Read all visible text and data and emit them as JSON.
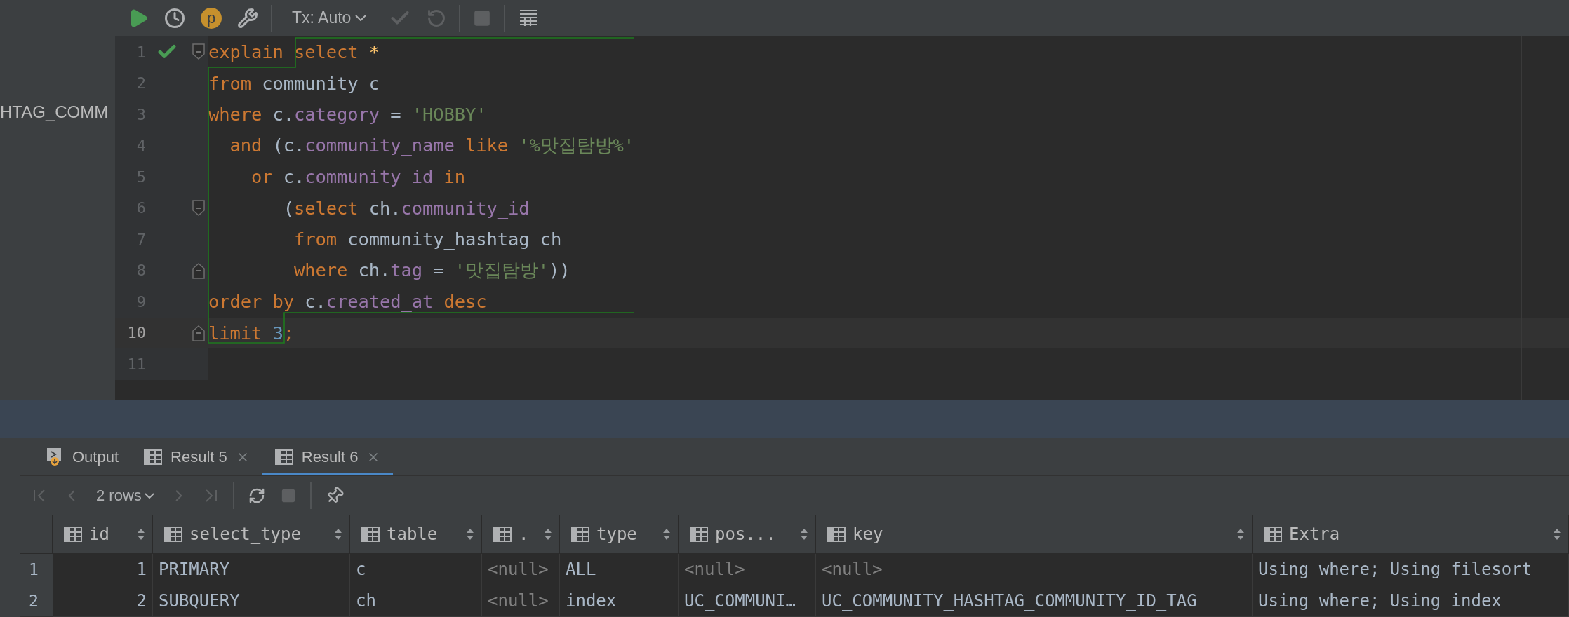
{
  "left_panel": {
    "text": "HTAG_COMM"
  },
  "toolbar": {
    "items": [
      {
        "kind": "run",
        "disabled": false
      },
      {
        "kind": "history",
        "disabled": false
      },
      {
        "kind": "profile",
        "label": "p",
        "disabled": false
      },
      {
        "kind": "settings",
        "disabled": false
      },
      {
        "kind": "separator"
      },
      {
        "kind": "tx",
        "label": "Tx: Auto",
        "disabled": false
      },
      {
        "kind": "commit",
        "disabled": true
      },
      {
        "kind": "rollback",
        "disabled": true
      },
      {
        "kind": "separator"
      },
      {
        "kind": "stop",
        "disabled": true
      },
      {
        "kind": "separator"
      },
      {
        "kind": "table",
        "disabled": false
      }
    ]
  },
  "editor": {
    "lines": [
      {
        "number": "1",
        "check": true,
        "current": false,
        "fold_start": true,
        "fold_end": false,
        "tokens": [
          {
            "kind": "keyword",
            "text": "explain select "
          },
          {
            "kind": "star",
            "text": "*"
          }
        ]
      },
      {
        "number": "2",
        "check": false,
        "current": false,
        "fold_start": false,
        "fold_end": false,
        "tokens": [
          {
            "kind": "keyword",
            "text": "from "
          },
          {
            "kind": "ident",
            "text": "community c"
          }
        ]
      },
      {
        "number": "3",
        "check": false,
        "current": false,
        "fold_start": false,
        "fold_end": false,
        "tokens": [
          {
            "kind": "keyword",
            "text": "where "
          },
          {
            "kind": "ident",
            "text": "c."
          },
          {
            "kind": "field",
            "text": "category"
          },
          {
            "kind": "ident",
            "text": " = "
          },
          {
            "kind": "string",
            "text": "'HOBBY'"
          }
        ]
      },
      {
        "number": "4",
        "check": false,
        "current": false,
        "fold_start": false,
        "fold_end": false,
        "tokens": [
          {
            "kind": "keyword",
            "text": "  and "
          },
          {
            "kind": "ident",
            "text": "(c."
          },
          {
            "kind": "field",
            "text": "community_name"
          },
          {
            "kind": "keyword",
            "text": " like "
          },
          {
            "kind": "string",
            "text": "'%맛집탐방%'"
          }
        ]
      },
      {
        "number": "5",
        "check": false,
        "current": false,
        "fold_start": false,
        "fold_end": false,
        "tokens": [
          {
            "kind": "keyword",
            "text": "    or "
          },
          {
            "kind": "ident",
            "text": "c."
          },
          {
            "kind": "field",
            "text": "community_id"
          },
          {
            "kind": "keyword",
            "text": " in"
          }
        ]
      },
      {
        "number": "6",
        "check": false,
        "current": false,
        "fold_start": true,
        "fold_end": false,
        "tokens": [
          {
            "kind": "ident",
            "text": "       ("
          },
          {
            "kind": "keyword",
            "text": "select "
          },
          {
            "kind": "ident",
            "text": "ch."
          },
          {
            "kind": "field",
            "text": "community_id"
          }
        ]
      },
      {
        "number": "7",
        "check": false,
        "current": false,
        "fold_start": false,
        "fold_end": false,
        "tokens": [
          {
            "kind": "keyword",
            "text": "        from "
          },
          {
            "kind": "ident",
            "text": "community_hashtag ch"
          }
        ]
      },
      {
        "number": "8",
        "check": false,
        "current": false,
        "fold_start": false,
        "fold_end": true,
        "tokens": [
          {
            "kind": "keyword",
            "text": "        where "
          },
          {
            "kind": "ident",
            "text": "ch."
          },
          {
            "kind": "field",
            "text": "tag"
          },
          {
            "kind": "ident",
            "text": " = "
          },
          {
            "kind": "string",
            "text": "'맛집탐방'"
          },
          {
            "kind": "ident",
            "text": "))"
          }
        ]
      },
      {
        "number": "9",
        "check": false,
        "current": false,
        "fold_start": false,
        "fold_end": false,
        "tokens": [
          {
            "kind": "keyword",
            "text": "order by "
          },
          {
            "kind": "ident",
            "text": "c."
          },
          {
            "kind": "field",
            "text": "created_at"
          },
          {
            "kind": "keyword",
            "text": " desc"
          }
        ]
      },
      {
        "number": "10",
        "check": false,
        "current": true,
        "fold_start": false,
        "fold_end": true,
        "tokens": [
          {
            "kind": "keyword",
            "text": "limit "
          },
          {
            "kind": "number",
            "text": "3"
          },
          {
            "kind": "keyword",
            "text": ";"
          }
        ]
      },
      {
        "number": "11",
        "check": false,
        "current": false,
        "fold_start": false,
        "fold_end": false
      }
    ]
  },
  "result_tabs": [
    {
      "kind": "output",
      "label": "Output",
      "selected": false,
      "closable": false
    },
    {
      "kind": "table",
      "label": "Result 5",
      "selected": false,
      "closable": true
    },
    {
      "kind": "table",
      "label": "Result 6",
      "selected": true,
      "closable": true
    }
  ],
  "result_toolbar": {
    "rows_label": "2 rows"
  },
  "table": {
    "columns": [
      {
        "name": "id",
        "kind": "number"
      },
      {
        "name": "select_type",
        "kind": "text"
      },
      {
        "name": "table",
        "kind": "text"
      },
      {
        "name": ".",
        "kind": "text"
      },
      {
        "name": "type",
        "kind": "text"
      },
      {
        "name": "pos...",
        "kind": "text"
      },
      {
        "name": "key",
        "kind": "text"
      },
      {
        "name": "Extra",
        "kind": "text"
      }
    ],
    "rows": [
      {
        "number": "1",
        "cells": [
          {
            "text": "1",
            "is_null": false
          },
          {
            "text": "PRIMARY",
            "is_null": false
          },
          {
            "text": "c",
            "is_null": false
          },
          {
            "text": "<null>",
            "is_null": true
          },
          {
            "text": "ALL",
            "is_null": false
          },
          {
            "text": "<null>",
            "is_null": true
          },
          {
            "text": "<null>",
            "is_null": true
          },
          {
            "text": "Using where; Using filesort",
            "is_null": false
          }
        ]
      },
      {
        "number": "2",
        "cells": [
          {
            "text": "2",
            "is_null": false
          },
          {
            "text": "SUBQUERY",
            "is_null": false
          },
          {
            "text": "ch",
            "is_null": false
          },
          {
            "text": "<null>",
            "is_null": true
          },
          {
            "text": "index",
            "is_null": false
          },
          {
            "text": "UC_COMMUNI…",
            "is_null": false
          },
          {
            "text": "UC_COMMUNITY_HASHTAG_COMMUNITY_ID_TAG",
            "is_null": false
          },
          {
            "text": "Using where; Using index",
            "is_null": false
          }
        ]
      }
    ]
  }
}
